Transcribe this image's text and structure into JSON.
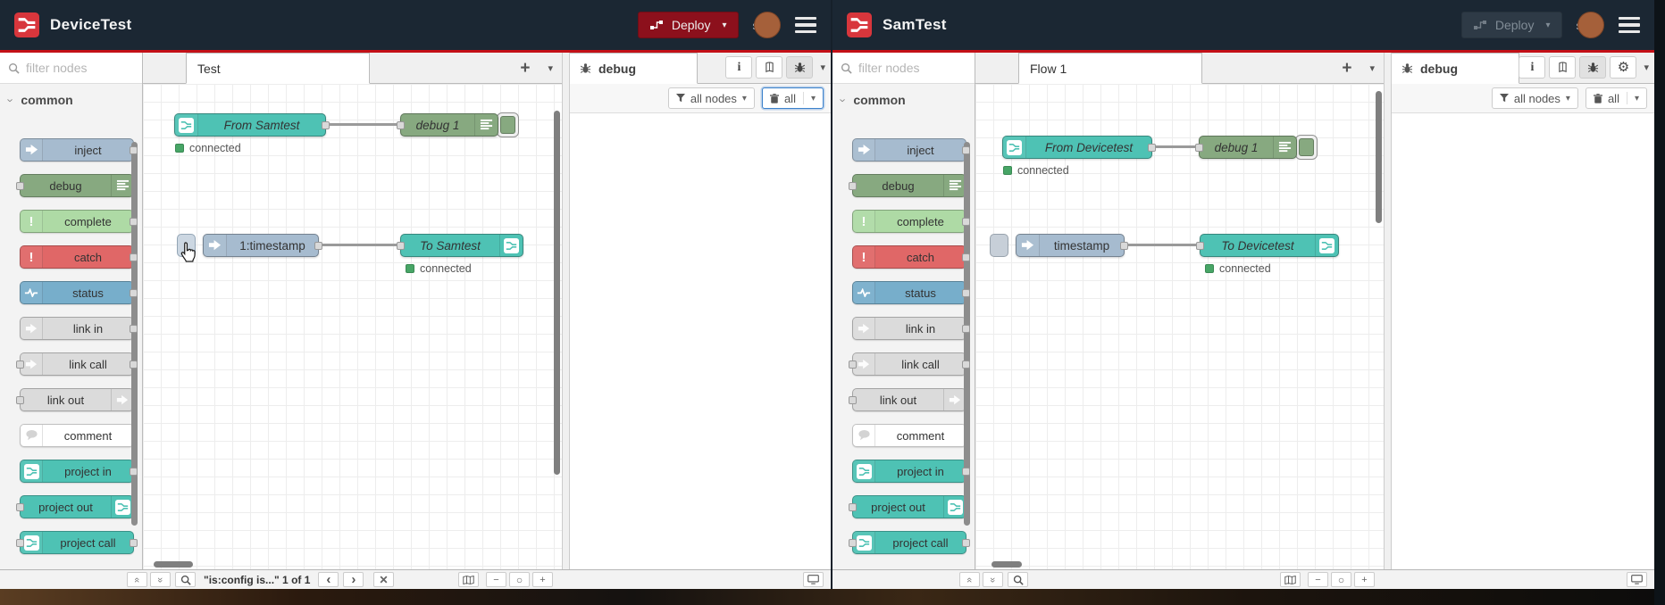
{
  "colors": {
    "header_bg": "#1b2733",
    "deploy_red": "#8c101c",
    "header_underline": "#c41017",
    "node_inject": "#a6bbcf",
    "node_debug": "#87a980",
    "node_complete": "#aedaa5",
    "node_catch": "#e06767",
    "node_status": "#77aecb",
    "node_link": "#dbdbdb",
    "node_comment": "#ffffff",
    "node_project": "#4ec2b4",
    "status_dot_green": "#47a566"
  },
  "palette": {
    "filter_placeholder": "filter nodes",
    "category_label": "common",
    "items": [
      "inject",
      "debug",
      "complete",
      "catch",
      "status",
      "link in",
      "link call",
      "link out",
      "comment",
      "project in",
      "project out",
      "project call"
    ]
  },
  "left": {
    "header": {
      "title": "DeviceTest",
      "deploy_label": "Deploy",
      "user_label": "s"
    },
    "workspace": {
      "tab_label": "Test",
      "add_tab_label": "+"
    },
    "flow": {
      "project_in_label": "From Samtest",
      "project_in_status": "connected",
      "debug_label": "debug 1",
      "inject_label": "1:timestamp",
      "project_out_label": "To Samtest",
      "project_out_status": "connected"
    },
    "sidebar": {
      "tab_label": "debug",
      "info_label": "i",
      "filter_button": "all nodes",
      "clear_button": "all"
    },
    "footer": {
      "search_result": "\"is:config is...\" 1 of 1"
    }
  },
  "right": {
    "header": {
      "title": "SamTest",
      "deploy_label": "Deploy",
      "user_label": "s"
    },
    "workspace": {
      "tab_label": "Flow 1",
      "add_tab_label": "+"
    },
    "flow": {
      "project_in_label": "From Devicetest",
      "project_in_status": "connected",
      "debug_label": "debug 1",
      "inject_label": "timestamp",
      "project_out_label": "To Devicetest",
      "project_out_status": "connected"
    },
    "sidebar": {
      "tab_label": "debug",
      "info_label": "i",
      "filter_button": "all nodes",
      "clear_button": "all"
    }
  }
}
